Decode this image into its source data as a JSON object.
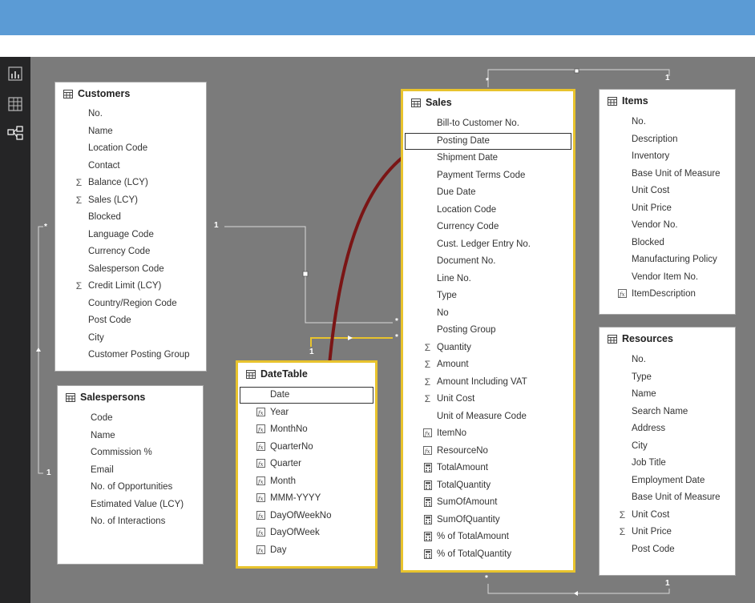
{
  "tables": {
    "customers": {
      "title": "Customers",
      "fields": [
        {
          "name": "No.",
          "icon": "none"
        },
        {
          "name": "Name",
          "icon": "none"
        },
        {
          "name": "Location Code",
          "icon": "none"
        },
        {
          "name": "Contact",
          "icon": "none"
        },
        {
          "name": "Balance (LCY)",
          "icon": "sigma"
        },
        {
          "name": "Sales (LCY)",
          "icon": "sigma"
        },
        {
          "name": "Blocked",
          "icon": "none"
        },
        {
          "name": "Language Code",
          "icon": "none"
        },
        {
          "name": "Currency Code",
          "icon": "none"
        },
        {
          "name": "Salesperson Code",
          "icon": "none"
        },
        {
          "name": "Credit Limit (LCY)",
          "icon": "sigma"
        },
        {
          "name": "Country/Region Code",
          "icon": "none"
        },
        {
          "name": "Post Code",
          "icon": "none"
        },
        {
          "name": "City",
          "icon": "none"
        },
        {
          "name": "Customer Posting Group",
          "icon": "none"
        }
      ]
    },
    "salespersons": {
      "title": "Salespersons",
      "fields": [
        {
          "name": "Code",
          "icon": "none"
        },
        {
          "name": "Name",
          "icon": "none"
        },
        {
          "name": "Commission %",
          "icon": "none"
        },
        {
          "name": "Email",
          "icon": "none"
        },
        {
          "name": "No. of Opportunities",
          "icon": "none"
        },
        {
          "name": "Estimated Value (LCY)",
          "icon": "none"
        },
        {
          "name": "No. of Interactions",
          "icon": "none"
        }
      ]
    },
    "datetable": {
      "title": "DateTable",
      "fields": [
        {
          "name": "Date",
          "icon": "none"
        },
        {
          "name": "Year",
          "icon": "calc-column"
        },
        {
          "name": "MonthNo",
          "icon": "calc-column"
        },
        {
          "name": "QuarterNo",
          "icon": "calc-column"
        },
        {
          "name": "Quarter",
          "icon": "calc-column"
        },
        {
          "name": "Month",
          "icon": "calc-column"
        },
        {
          "name": "MMM-YYYY",
          "icon": "calc-column"
        },
        {
          "name": "DayOfWeekNo",
          "icon": "calc-column"
        },
        {
          "name": "DayOfWeek",
          "icon": "calc-column"
        },
        {
          "name": "Day",
          "icon": "calc-column"
        }
      ]
    },
    "sales": {
      "title": "Sales",
      "fields": [
        {
          "name": "Bill-to Customer No.",
          "icon": "none"
        },
        {
          "name": "Posting Date",
          "icon": "none"
        },
        {
          "name": "Shipment Date",
          "icon": "none"
        },
        {
          "name": "Payment Terms Code",
          "icon": "none"
        },
        {
          "name": "Due Date",
          "icon": "none"
        },
        {
          "name": "Location Code",
          "icon": "none"
        },
        {
          "name": "Currency Code",
          "icon": "none"
        },
        {
          "name": "Cust. Ledger Entry No.",
          "icon": "none"
        },
        {
          "name": "Document No.",
          "icon": "none"
        },
        {
          "name": "Line No.",
          "icon": "none"
        },
        {
          "name": "Type",
          "icon": "none"
        },
        {
          "name": "No",
          "icon": "none"
        },
        {
          "name": "Posting Group",
          "icon": "none"
        },
        {
          "name": "Quantity",
          "icon": "sigma"
        },
        {
          "name": "Amount",
          "icon": "sigma"
        },
        {
          "name": "Amount Including VAT",
          "icon": "sigma"
        },
        {
          "name": "Unit Cost",
          "icon": "sigma"
        },
        {
          "name": "Unit of Measure Code",
          "icon": "none"
        },
        {
          "name": "ItemNo",
          "icon": "calc-column"
        },
        {
          "name": "ResourceNo",
          "icon": "calc-column"
        },
        {
          "name": "TotalAmount",
          "icon": "calculator"
        },
        {
          "name": "TotalQuantity",
          "icon": "calculator"
        },
        {
          "name": "SumOfAmount",
          "icon": "calculator"
        },
        {
          "name": "SumOfQuantity",
          "icon": "calculator"
        },
        {
          "name": "% of TotalAmount",
          "icon": "calculator"
        },
        {
          "name": "% of TotalQuantity",
          "icon": "calculator"
        }
      ]
    },
    "items": {
      "title": "Items",
      "fields": [
        {
          "name": "No.",
          "icon": "none"
        },
        {
          "name": "Description",
          "icon": "none"
        },
        {
          "name": "Inventory",
          "icon": "none"
        },
        {
          "name": "Base Unit of Measure",
          "icon": "none"
        },
        {
          "name": "Unit Cost",
          "icon": "none"
        },
        {
          "name": "Unit Price",
          "icon": "none"
        },
        {
          "name": "Vendor No.",
          "icon": "none"
        },
        {
          "name": "Blocked",
          "icon": "none"
        },
        {
          "name": "Manufacturing Policy",
          "icon": "none"
        },
        {
          "name": "Vendor Item No.",
          "icon": "none"
        },
        {
          "name": "ItemDescription",
          "icon": "calc-column"
        }
      ]
    },
    "resources": {
      "title": "Resources",
      "fields": [
        {
          "name": "No.",
          "icon": "none"
        },
        {
          "name": "Type",
          "icon": "none"
        },
        {
          "name": "Name",
          "icon": "none"
        },
        {
          "name": "Search Name",
          "icon": "none"
        },
        {
          "name": "Address",
          "icon": "none"
        },
        {
          "name": "City",
          "icon": "none"
        },
        {
          "name": "Job Title",
          "icon": "none"
        },
        {
          "name": "Employment Date",
          "icon": "none"
        },
        {
          "name": "Base Unit of Measure",
          "icon": "none"
        },
        {
          "name": "Unit Cost",
          "icon": "sigma"
        },
        {
          "name": "Unit Price",
          "icon": "sigma"
        },
        {
          "name": "Post Code",
          "icon": "none"
        }
      ]
    }
  },
  "relationship_labels": {
    "one": "1",
    "many": "*"
  },
  "sidebar": {
    "items": [
      "report-view",
      "data-view",
      "relationships-view"
    ],
    "active": "relationships-view"
  },
  "colors": {
    "topbar": "#5b9bd5",
    "canvas": "#7b7b7b",
    "selected_border": "#e8c32d",
    "arrow": "#7a1515",
    "relationship_line": "#d9d9d9"
  }
}
